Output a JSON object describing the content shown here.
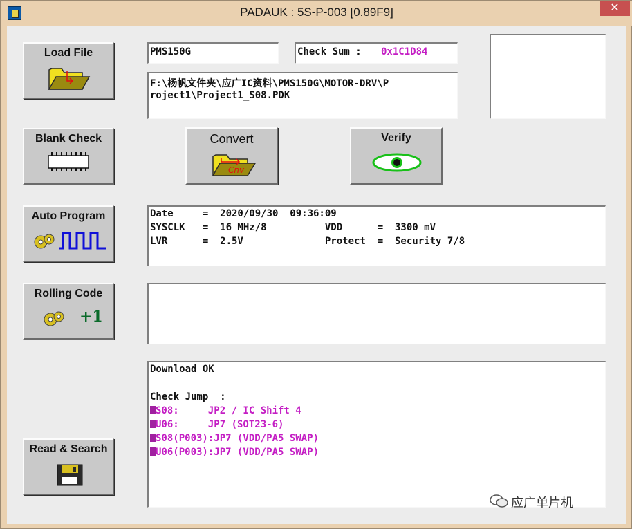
{
  "window": {
    "title": "PADAUK : 5S-P-003 [0.89F9]",
    "close_glyph": "✕"
  },
  "buttons": {
    "load_file": "Load File",
    "blank_check": "Blank Check",
    "convert": "Convert",
    "verify": "Verify",
    "auto_program": "Auto Program",
    "rolling_code": "Rolling Code",
    "rolling_code_increment": "+1",
    "read_search": "Read & Search",
    "convert_icon_text": "Cnv"
  },
  "file_info": {
    "ic_name": "PMS150G",
    "checksum_label": "Check Sum :",
    "checksum_value": "0x1C1D84",
    "path_line1": "F:\\杨帆文件夹\\应广IC资料\\PMS150G\\MOTOR-DRV\\P",
    "path_line2": "roject1\\Project1_S08.PDK"
  },
  "info": {
    "line1": "Date     =  2020/09/30  09:36:09",
    "line2": "SYSCLK   =  16 MHz/8          VDD      =  3300 mV",
    "line3": "LVR      =  2.5V              Protect  =  Security 7/8"
  },
  "log": {
    "line1": "Download OK",
    "line2": "Check Jump  :",
    "line3": "S08:     JP2 / IC Shift 4",
    "line4": "U06:     JP7 (SOT23-6)",
    "line5": "S08(P003):JP7 (VDD/PA5 SWAP)",
    "line6": "U06(P003):JP7 (VDD/PA5 SWAP)"
  },
  "watermark": {
    "text": "应广单片机"
  },
  "icons": [
    "folder-open-icon",
    "chip-icon",
    "convert-folder-icon",
    "eye-icon",
    "gear-icon",
    "square-wave-icon",
    "floppy-disk-icon",
    "wechat-icon"
  ],
  "colors": {
    "magenta": "#c41ec4",
    "wave_blue": "#1010d8",
    "folder_yellow": "#f0e020",
    "eye_green": "#18c018"
  }
}
